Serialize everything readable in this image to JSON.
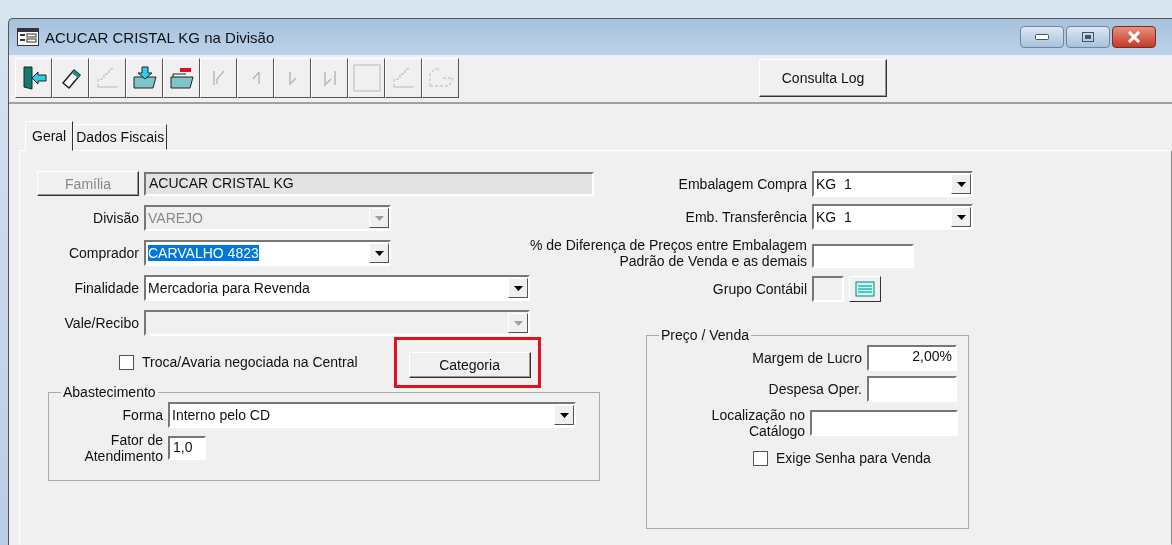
{
  "window": {
    "title": "ACUCAR CRISTAL KG na Divisão"
  },
  "toolbar": {
    "buttons": [
      {
        "kind": "exit",
        "disabled": false
      },
      {
        "kind": "eraser",
        "disabled": false
      },
      {
        "kind": "stairs",
        "disabled": true
      },
      {
        "kind": "folder-in",
        "disabled": false
      },
      {
        "kind": "folder-out",
        "disabled": false
      },
      {
        "kind": "first",
        "disabled": true
      },
      {
        "kind": "prev",
        "disabled": true
      },
      {
        "kind": "next",
        "disabled": true
      },
      {
        "kind": "last",
        "disabled": true
      },
      {
        "kind": "blank",
        "disabled": true
      },
      {
        "kind": "stairs",
        "disabled": true
      },
      {
        "kind": "folder-dash",
        "disabled": true
      }
    ],
    "log_button": "Consulta Log"
  },
  "tabs": [
    {
      "label": "Geral",
      "selected": true
    },
    {
      "label": "Dados Fiscais",
      "selected": false
    }
  ],
  "familia": {
    "button": "Família",
    "disabled": true,
    "value": "ACUCAR CRISTAL KG"
  },
  "left_fields": [
    {
      "label": "Divisão",
      "value": "VAREJO",
      "disabled": true,
      "text_selected": false
    },
    {
      "label": "Comprador",
      "value": "CARVALHO 4823",
      "disabled": false,
      "text_selected": true
    },
    {
      "label": "Finalidade",
      "value": "Mercadoria para Revenda",
      "disabled": false,
      "text_selected": false
    },
    {
      "label": "Vale/Recibo",
      "disabled": true
    }
  ],
  "troca_checkbox": {
    "label": "Troca/Avaria negociada na Central",
    "checked": false
  },
  "categoria_button": {
    "label": "Categoria",
    "highlighted": true
  },
  "abastecimento": {
    "title": "Abastecimento",
    "forma_label": "Forma",
    "forma_value": "Interno pelo CD",
    "fator_label_lines": [
      "Fator de",
      "Atendimento"
    ],
    "fator_value": "1,0"
  },
  "right_fields": [
    {
      "label": "Embalagem Compra",
      "value": "KG  1"
    },
    {
      "label": "Emb. Transferência",
      "value": "KG  1"
    }
  ],
  "diferenca": {
    "label_lines": [
      "% de Diferença de Preços entre Embalagem",
      "Padrão de Venda e as demais"
    ]
  },
  "grupo_contabil": {
    "label": "Grupo Contábil"
  },
  "preco_venda": {
    "title": "Preço / Venda",
    "margem_label": "Margem de Lucro",
    "margem_value": "2,00%",
    "despesa_label": "Despesa Oper.",
    "localizacao_label_lines": [
      "Localização no",
      "Catálogo"
    ],
    "exige_senha": {
      "label": "Exige Senha para Venda",
      "checked": false
    }
  }
}
